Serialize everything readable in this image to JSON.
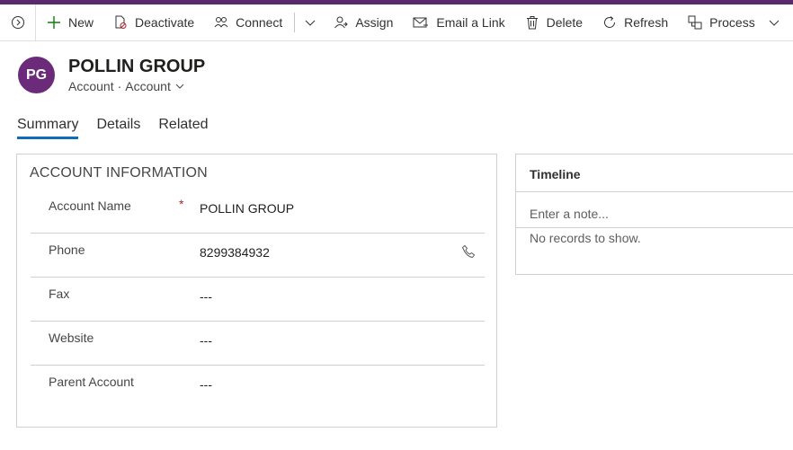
{
  "theme": {
    "accent": "#5b2a6e",
    "avatar_bg": "#6b2a7a",
    "tab_underline": "#0f6cbd"
  },
  "commands": [
    {
      "label": "New",
      "icon": "plus-icon"
    },
    {
      "label": "Deactivate",
      "icon": "deactivate-icon"
    },
    {
      "label": "Connect",
      "icon": "connect-icon"
    },
    {
      "label": "Assign",
      "icon": "assign-icon"
    },
    {
      "label": "Email a Link",
      "icon": "email-icon"
    },
    {
      "label": "Delete",
      "icon": "trash-icon"
    },
    {
      "label": "Refresh",
      "icon": "refresh-icon"
    },
    {
      "label": "Process",
      "icon": "process-icon"
    }
  ],
  "record": {
    "initials": "PG",
    "title": "POLLIN GROUP",
    "entity": "Account",
    "form": "Account"
  },
  "tabs": [
    "Summary",
    "Details",
    "Related"
  ],
  "account_info": {
    "title": "ACCOUNT INFORMATION",
    "fields": [
      {
        "label": "Account Name",
        "required": "*",
        "value": "POLLIN GROUP"
      },
      {
        "label": "Phone",
        "value": "8299384932"
      },
      {
        "label": "Fax",
        "value": "---"
      },
      {
        "label": "Website",
        "value": "---"
      },
      {
        "label": "Parent Account",
        "value": "---"
      }
    ]
  },
  "timeline": {
    "title": "Timeline",
    "note_placeholder": "Enter a note...",
    "empty": "No records to show."
  }
}
